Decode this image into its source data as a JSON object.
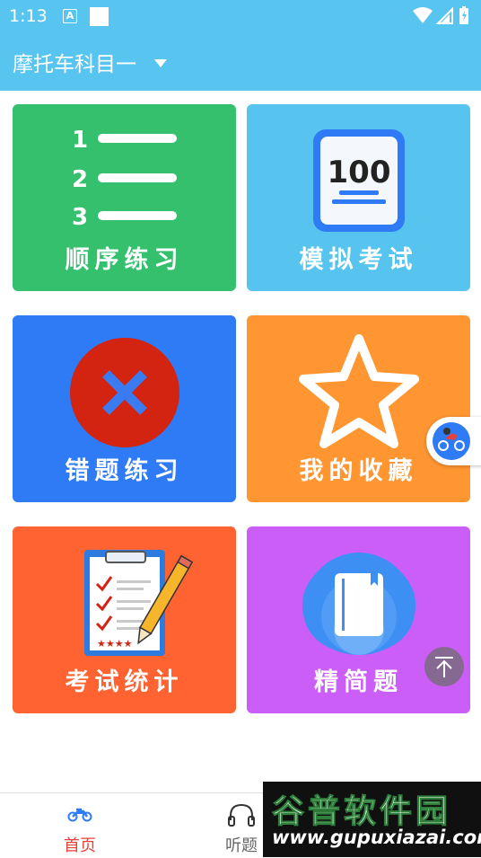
{
  "status_bar": {
    "time": "1:13",
    "notification_letter": "A"
  },
  "app_bar": {
    "title": "摩托车科目一"
  },
  "tiles": [
    {
      "label": "顺序练习",
      "color": "#35c06e",
      "icon": "numbered-list-icon",
      "numbers": [
        "1",
        "2",
        "3"
      ]
    },
    {
      "label": "模拟考试",
      "color": "#57c3ef",
      "icon": "exam-100-icon",
      "score": "100"
    },
    {
      "label": "错题练习",
      "color": "#2f7af5",
      "icon": "wrong-x-icon"
    },
    {
      "label": "我的收藏",
      "color": "#ff9632",
      "icon": "star-icon"
    },
    {
      "label": "考试统计",
      "color": "#ff6331",
      "icon": "clipboard-checklist-icon"
    },
    {
      "label": "精简题",
      "color": "#cb5ef7",
      "icon": "book-icon"
    }
  ],
  "bottom_nav": {
    "items": [
      {
        "label": "首页",
        "icon": "motorcycle-icon",
        "active": true,
        "color": "#e8403a"
      },
      {
        "label": "听题",
        "icon": "headphones-icon",
        "active": false,
        "color": "#666666"
      }
    ]
  },
  "watermark": {
    "title": "谷普软件园",
    "url": "www.gupuxiazai.com"
  }
}
